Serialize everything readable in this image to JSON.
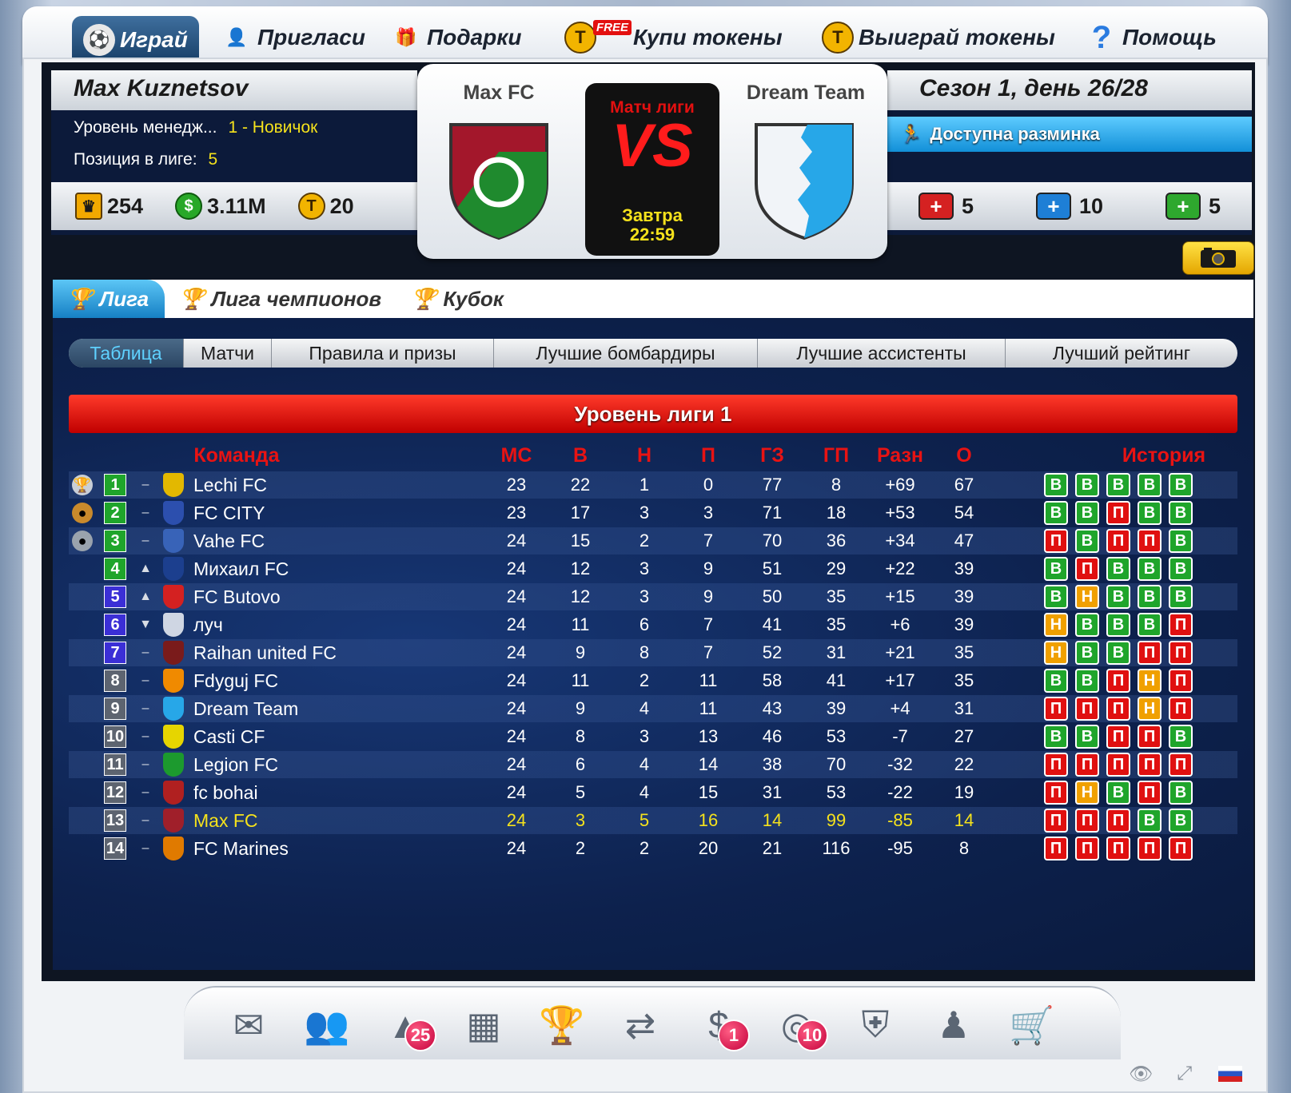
{
  "nav": [
    {
      "label": "Играй",
      "icon": "soccer-ball-icon",
      "active": true
    },
    {
      "label": "Пригласи",
      "icon": "add-user-icon"
    },
    {
      "label": "Подарки",
      "icon": "gift-icon"
    },
    {
      "label": "Купи токены",
      "icon": "token-icon",
      "badge": "FREE"
    },
    {
      "label": "Выиграй токены",
      "icon": "token-icon"
    },
    {
      "label": "Помощь",
      "icon": "help-icon"
    }
  ],
  "manager": {
    "name": "Max Kuznetsov",
    "level_label": "Уровень менедж...",
    "level_value": "1 - Новичок",
    "position_label": "Позиция в лиге:",
    "position_value": "5",
    "trophies": "254",
    "money": "3.11M",
    "tokens": "20"
  },
  "match": {
    "home": "Max FC",
    "away": "Dream Team",
    "type": "Матч лиги",
    "vs": "VS",
    "when_day": "Завтра",
    "when_time": "22:59"
  },
  "season": {
    "title": "Сезон 1, день 26/28",
    "warmup": "Доступна разминка",
    "kits": [
      {
        "value": "5",
        "color": "#d52121"
      },
      {
        "value": "10",
        "color": "#1e7fd6"
      },
      {
        "value": "5",
        "color": "#2ea82e"
      }
    ]
  },
  "tabs": [
    "Лига",
    "Лига чемпионов",
    "Кубок"
  ],
  "subtabs": [
    "Таблица",
    "Матчи",
    "Правила и призы",
    "Лучшие бомбардиры",
    "Лучшие ассистенты",
    "Лучший рейтинг"
  ],
  "league_title": "Уровень лиги 1",
  "columns": {
    "team": "Команда",
    "mp": "МС",
    "w": "В",
    "d": "Н",
    "l": "П",
    "gf": "ГЗ",
    "ga": "ГП",
    "gd": "Разн",
    "pts": "О",
    "history": "История"
  },
  "table": [
    {
      "pos": "1",
      "trend": "–",
      "team": "Lechi FC",
      "mp": "23",
      "w": "22",
      "d": "1",
      "l": "0",
      "gf": "77",
      "ga": "8",
      "gd": "+69",
      "pts": "67",
      "hist": [
        "В",
        "В",
        "В",
        "В",
        "В"
      ],
      "crest": "#e3b800"
    },
    {
      "pos": "2",
      "trend": "–",
      "team": "FC CITY",
      "mp": "23",
      "w": "17",
      "d": "3",
      "l": "3",
      "gf": "71",
      "ga": "18",
      "gd": "+53",
      "pts": "54",
      "hist": [
        "В",
        "В",
        "П",
        "В",
        "В"
      ],
      "crest": "#2c4fae"
    },
    {
      "pos": "3",
      "trend": "–",
      "team": "Vahe FC",
      "mp": "24",
      "w": "15",
      "d": "2",
      "l": "7",
      "gf": "70",
      "ga": "36",
      "gd": "+34",
      "pts": "47",
      "hist": [
        "П",
        "В",
        "П",
        "П",
        "В"
      ],
      "crest": "#3863b8"
    },
    {
      "pos": "4",
      "trend": "▲",
      "team": "Михаил FC",
      "mp": "24",
      "w": "12",
      "d": "3",
      "l": "9",
      "gf": "51",
      "ga": "29",
      "gd": "+22",
      "pts": "39",
      "hist": [
        "В",
        "П",
        "В",
        "В",
        "В"
      ],
      "crest": "#1c3f8e"
    },
    {
      "pos": "5",
      "trend": "▲",
      "team": "FC Butovo",
      "mp": "24",
      "w": "12",
      "d": "3",
      "l": "9",
      "gf": "50",
      "ga": "35",
      "gd": "+15",
      "pts": "39",
      "hist": [
        "В",
        "Н",
        "В",
        "В",
        "В"
      ],
      "crest": "#d42121"
    },
    {
      "pos": "6",
      "trend": "▼",
      "team": "луч",
      "mp": "24",
      "w": "11",
      "d": "6",
      "l": "7",
      "gf": "41",
      "ga": "35",
      "gd": "+6",
      "pts": "39",
      "hist": [
        "Н",
        "В",
        "В",
        "В",
        "П"
      ],
      "crest": "#cfd6e3"
    },
    {
      "pos": "7",
      "trend": "–",
      "team": "Raihan united FC",
      "mp": "24",
      "w": "9",
      "d": "8",
      "l": "7",
      "gf": "52",
      "ga": "31",
      "gd": "+21",
      "pts": "35",
      "hist": [
        "Н",
        "В",
        "В",
        "П",
        "П"
      ],
      "crest": "#7a1b1b"
    },
    {
      "pos": "8",
      "trend": "–",
      "team": "Fdyguj FC",
      "mp": "24",
      "w": "11",
      "d": "2",
      "l": "11",
      "gf": "58",
      "ga": "41",
      "gd": "+17",
      "pts": "35",
      "hist": [
        "В",
        "В",
        "П",
        "Н",
        "П"
      ],
      "crest": "#f08a00"
    },
    {
      "pos": "9",
      "trend": "–",
      "team": "Dream Team",
      "mp": "24",
      "w": "9",
      "d": "4",
      "l": "11",
      "gf": "43",
      "ga": "39",
      "gd": "+4",
      "pts": "31",
      "hist": [
        "П",
        "П",
        "П",
        "Н",
        "П"
      ],
      "crest": "#27a7e8"
    },
    {
      "pos": "10",
      "trend": "–",
      "team": "Casti CF",
      "mp": "24",
      "w": "8",
      "d": "3",
      "l": "13",
      "gf": "46",
      "ga": "53",
      "gd": "-7",
      "pts": "27",
      "hist": [
        "В",
        "В",
        "П",
        "П",
        "В"
      ],
      "crest": "#e6d500"
    },
    {
      "pos": "11",
      "trend": "–",
      "team": "Legion FC",
      "mp": "24",
      "w": "6",
      "d": "4",
      "l": "14",
      "gf": "38",
      "ga": "70",
      "gd": "-32",
      "pts": "22",
      "hist": [
        "П",
        "П",
        "П",
        "П",
        "П"
      ],
      "crest": "#1c9a2e"
    },
    {
      "pos": "12",
      "trend": "–",
      "team": "fc bohai",
      "mp": "24",
      "w": "5",
      "d": "4",
      "l": "15",
      "gf": "31",
      "ga": "53",
      "gd": "-22",
      "pts": "19",
      "hist": [
        "П",
        "Н",
        "В",
        "П",
        "В"
      ],
      "crest": "#b02020"
    },
    {
      "pos": "13",
      "trend": "–",
      "team": "Max FC",
      "mp": "24",
      "w": "3",
      "d": "5",
      "l": "16",
      "gf": "14",
      "ga": "99",
      "gd": "-85",
      "pts": "14",
      "hist": [
        "П",
        "П",
        "П",
        "В",
        "В"
      ],
      "crest": "#a01f2a",
      "me": true
    },
    {
      "pos": "14",
      "trend": "–",
      "team": "FC Marines",
      "mp": "24",
      "w": "2",
      "d": "2",
      "l": "20",
      "gf": "21",
      "ga": "116",
      "gd": "-95",
      "pts": "8",
      "hist": [
        "П",
        "П",
        "П",
        "П",
        "П"
      ],
      "crest": "#e07a00"
    }
  ],
  "dock": [
    {
      "name": "mail-icon",
      "glyph": "✉"
    },
    {
      "name": "squad-icon",
      "glyph": "👥"
    },
    {
      "name": "training-cone-icon",
      "glyph": "▲",
      "badge": "25"
    },
    {
      "name": "calendar-icon",
      "glyph": "▦"
    },
    {
      "name": "podium-icon",
      "glyph": "🏆"
    },
    {
      "name": "transfer-arrows-icon",
      "glyph": "⇄"
    },
    {
      "name": "finances-icon",
      "glyph": "$",
      "badge": "1"
    },
    {
      "name": "stadium-icon",
      "glyph": "◎",
      "badge": "10"
    },
    {
      "name": "kit-shield-icon",
      "glyph": "⛨"
    },
    {
      "name": "manager-suit-icon",
      "glyph": "♟"
    },
    {
      "name": "shop-cart-icon",
      "glyph": "🛒"
    }
  ],
  "colors": {
    "win": "#1fa52b",
    "loss": "#e01010",
    "draw": "#f0a000",
    "accent": "#e81313",
    "highlight": "#f5e21c"
  }
}
